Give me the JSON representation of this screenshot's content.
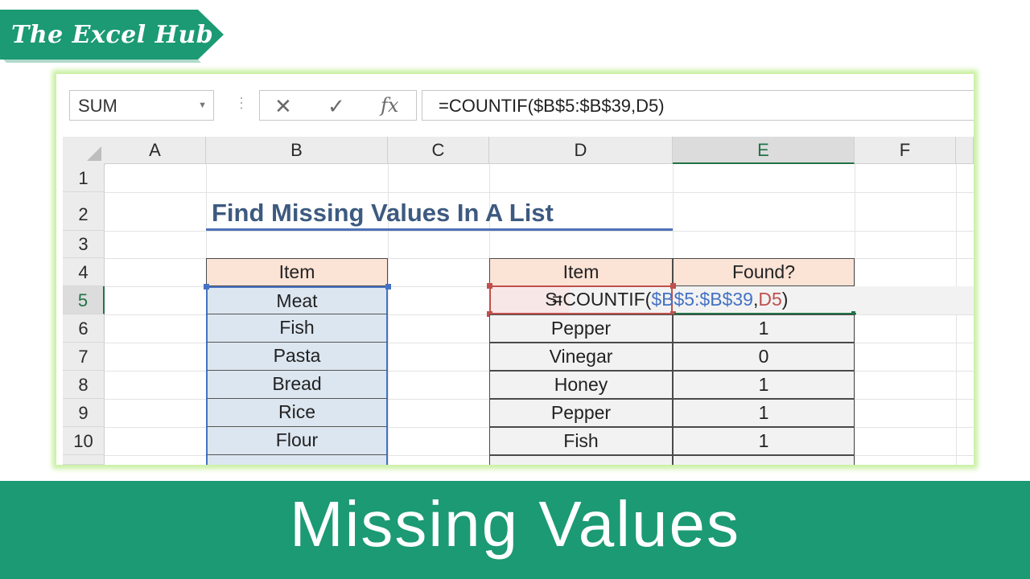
{
  "brand": {
    "text": "The Excel Hub"
  },
  "formula_bar": {
    "name_box": "SUM",
    "cancel_icon": "✕",
    "enter_icon": "✓",
    "fx_label": "fx",
    "formula": "=COUNTIF($B$5:$B$39,D5)"
  },
  "columns": [
    "A",
    "B",
    "C",
    "D",
    "E",
    "F"
  ],
  "rows": [
    "1",
    "2",
    "3",
    "4",
    "5",
    "6",
    "7",
    "8",
    "9",
    "10"
  ],
  "sheet": {
    "title": "Find Missing Values In A List",
    "list_header": "Item",
    "list_items": [
      "Meat",
      "Fish",
      "Pasta",
      "Bread",
      "Rice",
      "Flour"
    ],
    "lookup_header_item": "Item",
    "lookup_header_found": "Found?",
    "d5_partial": "Sı",
    "editing_formula": {
      "fn": "=COUNTIF(",
      "range": "$B$5:$B$39",
      "comma": ",",
      "ref": "D5",
      "close": ")"
    },
    "lookup_rows": [
      {
        "item": "Pepper",
        "found": "1"
      },
      {
        "item": "Vinegar",
        "found": "0"
      },
      {
        "item": "Honey",
        "found": "1"
      },
      {
        "item": "Pepper",
        "found": "1"
      },
      {
        "item": "Fish",
        "found": "1"
      }
    ]
  },
  "banner": {
    "text": "Missing Values"
  },
  "colors": {
    "brand_green": "#1b9a73",
    "excel_green": "#217346",
    "range_blue": "#4472c4",
    "ref_red": "#c0504d",
    "header_fill": "#fbe3d6",
    "list_fill": "#dce6f0"
  }
}
